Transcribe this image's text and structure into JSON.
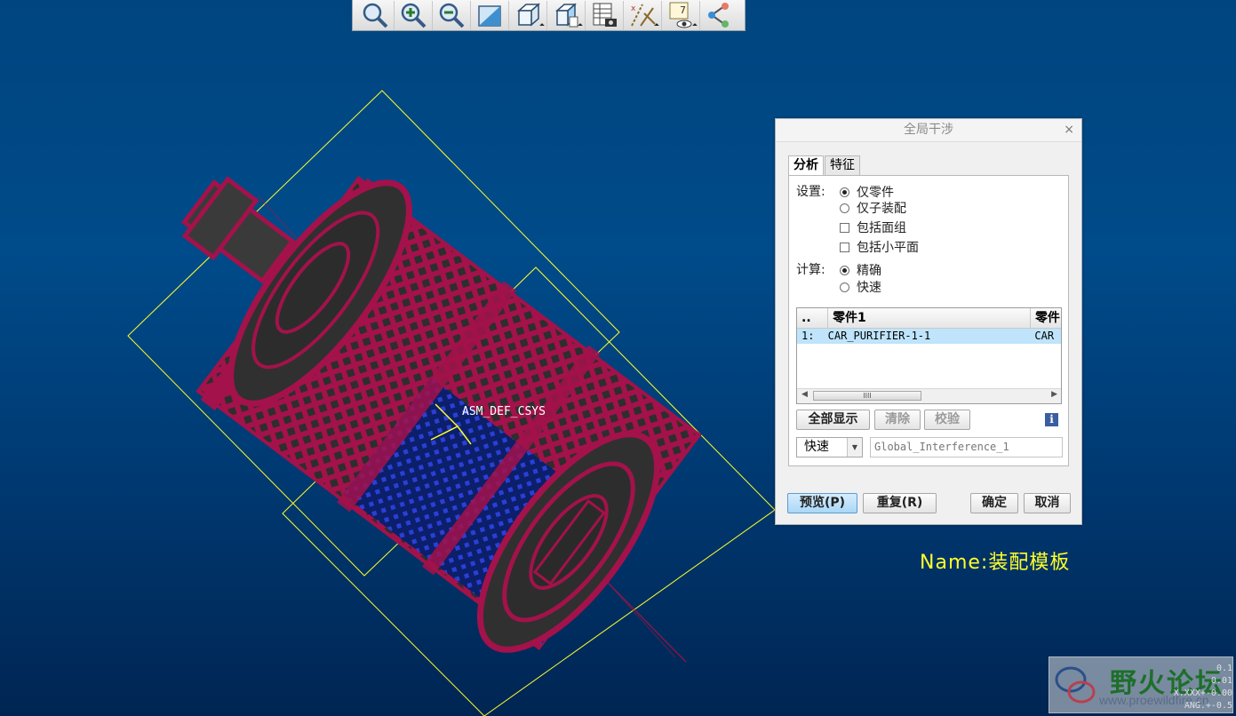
{
  "toolbar": {
    "buttons": [
      "zoom-fit",
      "zoom-in",
      "zoom-out",
      "repaint",
      "saved-views",
      "view-manager",
      "model-tree-settings",
      "datum-display",
      "annotation-display",
      "spin-center"
    ]
  },
  "model": {
    "csys_label": "ASM_DEF_CSYS",
    "colors": {
      "mesh": "#a3124a",
      "body": "#353535",
      "blue_mesh": "#1d2dcc",
      "datum": "#ffff2a",
      "axis": "#b01040"
    }
  },
  "dialog": {
    "title": "全局干涉",
    "close": "×",
    "tabs": [
      "分析",
      "特征"
    ],
    "settings_label": "设置:",
    "settings_options": [
      "仅零件",
      "仅子装配"
    ],
    "checkbox_options": [
      "包括面组",
      "包括小平面"
    ],
    "compute_label": "计算:",
    "compute_options": [
      "精确",
      "快速"
    ],
    "list": {
      "columns": [
        "..",
        "零件1",
        "零件"
      ],
      "rows": [
        {
          "index": "1:",
          "part1": "CAR_PURIFIER-1-1",
          "part2": "CAR"
        }
      ],
      "thumb_grip": "IIII"
    },
    "buttons": {
      "show_all": "全部显示",
      "clear": "清除",
      "verify": "校验"
    },
    "info_icon": "i",
    "mode_select": "快速",
    "name_field": "Global_Interference_1",
    "footer": {
      "preview": "预览(P)",
      "repeat": "重复(R)",
      "ok": "确定",
      "cancel": "取消"
    }
  },
  "name_annotation": "Name:装配模板",
  "watermark": {
    "text": "野火论坛",
    "url": "www.proewildfire.cn"
  },
  "coord_readout": [
    "0.1",
    "0.01",
    "X.XXX+-0.00",
    "ANG.+-0.5"
  ]
}
